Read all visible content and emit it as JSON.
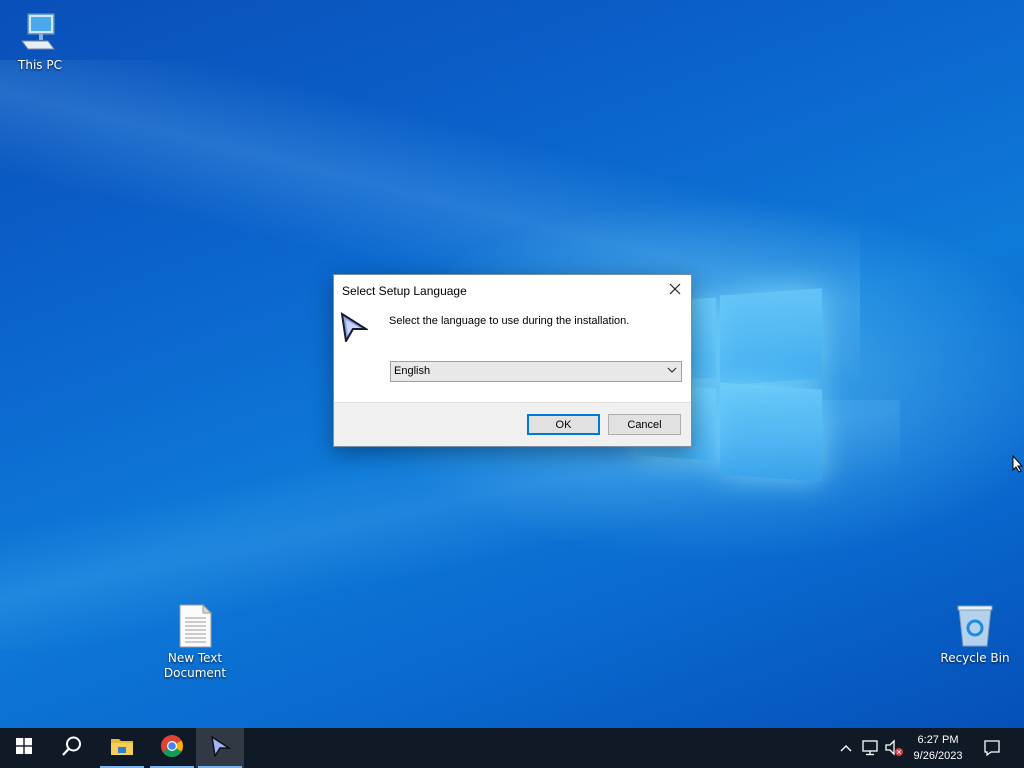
{
  "desktop": {
    "icons": [
      {
        "label": "This PC",
        "icon": "computer-icon"
      },
      {
        "label": "New Text Document",
        "icon": "text-document-icon"
      },
      {
        "label": "Recycle Bin",
        "icon": "recycle-bin-icon"
      }
    ]
  },
  "dialog": {
    "title": "Select Setup Language",
    "prompt": "Select the language to use during the installation.",
    "language_selected": "English",
    "ok_label": "OK",
    "cancel_label": "Cancel",
    "app_icon": "setup-arrow-icon"
  },
  "taskbar": {
    "buttons": [
      "start-icon",
      "search-icon",
      "file-explorer-icon",
      "chrome-icon",
      "setup-arrow-icon"
    ],
    "tray": [
      "chevron-up-icon",
      "network-icon",
      "volume-muted-icon"
    ],
    "time": "6:27 PM",
    "date": "9/26/2023",
    "notification_icon": "notification-icon"
  },
  "colors": {
    "accent": "#0078d7",
    "taskbar_bg": "#101a26"
  }
}
